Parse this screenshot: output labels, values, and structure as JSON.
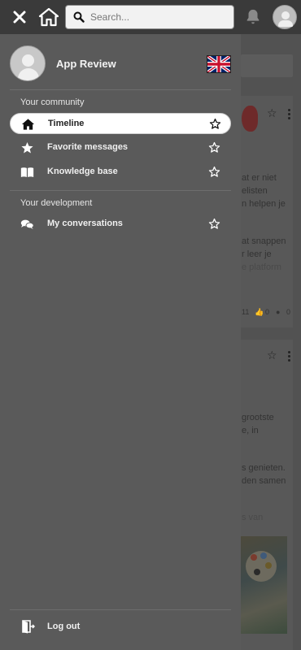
{
  "search": {
    "placeholder": "Search..."
  },
  "profile": {
    "name": "App Review"
  },
  "sections": {
    "community": "Your community",
    "development": "Your development"
  },
  "nav": {
    "timeline": "Timeline",
    "favorites": "Favorite messages",
    "knowledge": "Knowledge base",
    "conversations": "My conversations",
    "logout": "Log out"
  },
  "background": {
    "card1_lines": [
      "at er niet",
      "elisten",
      "n helpen je",
      "at snappen",
      "r leer je",
      "e platform"
    ],
    "card1_stats": {
      "views": "11",
      "likes": "0",
      "comments": "0"
    },
    "card2_lines": [
      "grootste",
      "e, in",
      "s genieten.",
      "den samen",
      "s van"
    ]
  },
  "colors": {
    "drawer_bg": "#5a5a5a",
    "topbar_bg": "#3a3a3a",
    "active_bg": "#ffffff"
  }
}
